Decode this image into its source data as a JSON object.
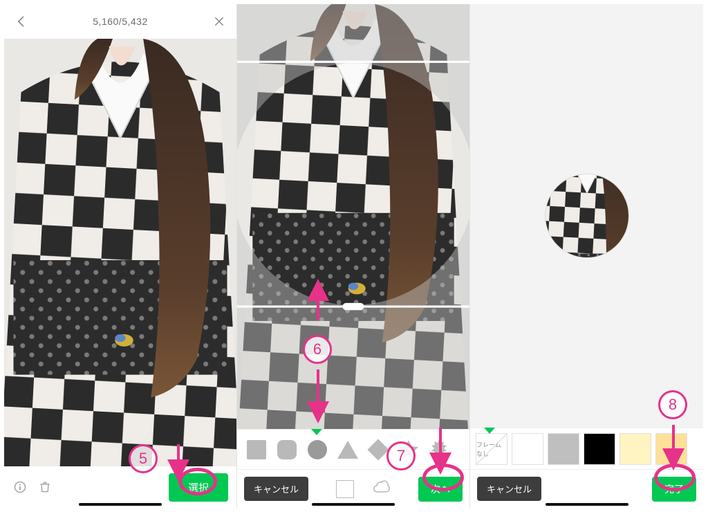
{
  "accent_color": "#00c853",
  "annotation_color": "#e73289",
  "panel1": {
    "counter": "5,160/5,432",
    "back_icon": "back-arrow",
    "close_icon": "close-x",
    "info_icon": "info",
    "trash_icon": "trash",
    "select_label": "選択"
  },
  "panel2": {
    "shapes": [
      {
        "name": "square",
        "selected": false
      },
      {
        "name": "rounded-square",
        "selected": false
      },
      {
        "name": "circle",
        "selected": true
      },
      {
        "name": "triangle",
        "selected": false
      },
      {
        "name": "diamond",
        "selected": false
      },
      {
        "name": "star",
        "selected": false
      },
      {
        "name": "burst",
        "selected": false
      }
    ],
    "crop_tool": "square-outline",
    "shape_tool": "cloud-outline",
    "cancel_label": "キャンセル",
    "next_label": "次へ"
  },
  "panel3": {
    "frames": [
      {
        "label": "フレームなし",
        "color": null
      },
      {
        "label": "",
        "color": "#ffffff"
      },
      {
        "label": "",
        "color": "#bfbfbf"
      },
      {
        "label": "",
        "color": "#000000"
      },
      {
        "label": "",
        "color": "#fff4c2"
      },
      {
        "label": "",
        "color": "#ffe099"
      }
    ],
    "selected_frame_index": 0,
    "cancel_label": "キャンセル",
    "done_label": "完了"
  },
  "annotations": {
    "step5": "5",
    "step6": "6",
    "step7": "7",
    "step8": "8"
  }
}
